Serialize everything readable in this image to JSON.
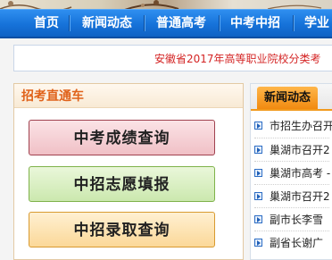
{
  "nav": {
    "items": [
      "首页",
      "新闻动态",
      "普通高考",
      "中考中招",
      "学业"
    ]
  },
  "marquee": {
    "text": "安徽省2017年高等职业院校分类考"
  },
  "left_panel": {
    "title": "招考直通车",
    "buttons": [
      "中考成绩查询",
      "中招志愿填报",
      "中招录取查询"
    ]
  },
  "right_panel": {
    "tab": "新闻动态",
    "news": [
      "市招生办召开",
      "巢湖市召开2",
      "巢湖市高考 -",
      "巢湖市召开2",
      "副市长李雪",
      "副省长谢广"
    ]
  },
  "colors": {
    "nav_blue": "#1672d9",
    "marquee_red": "#d42424",
    "panel_title_orange": "#e0621a",
    "tab_orange": "#f18a10"
  }
}
